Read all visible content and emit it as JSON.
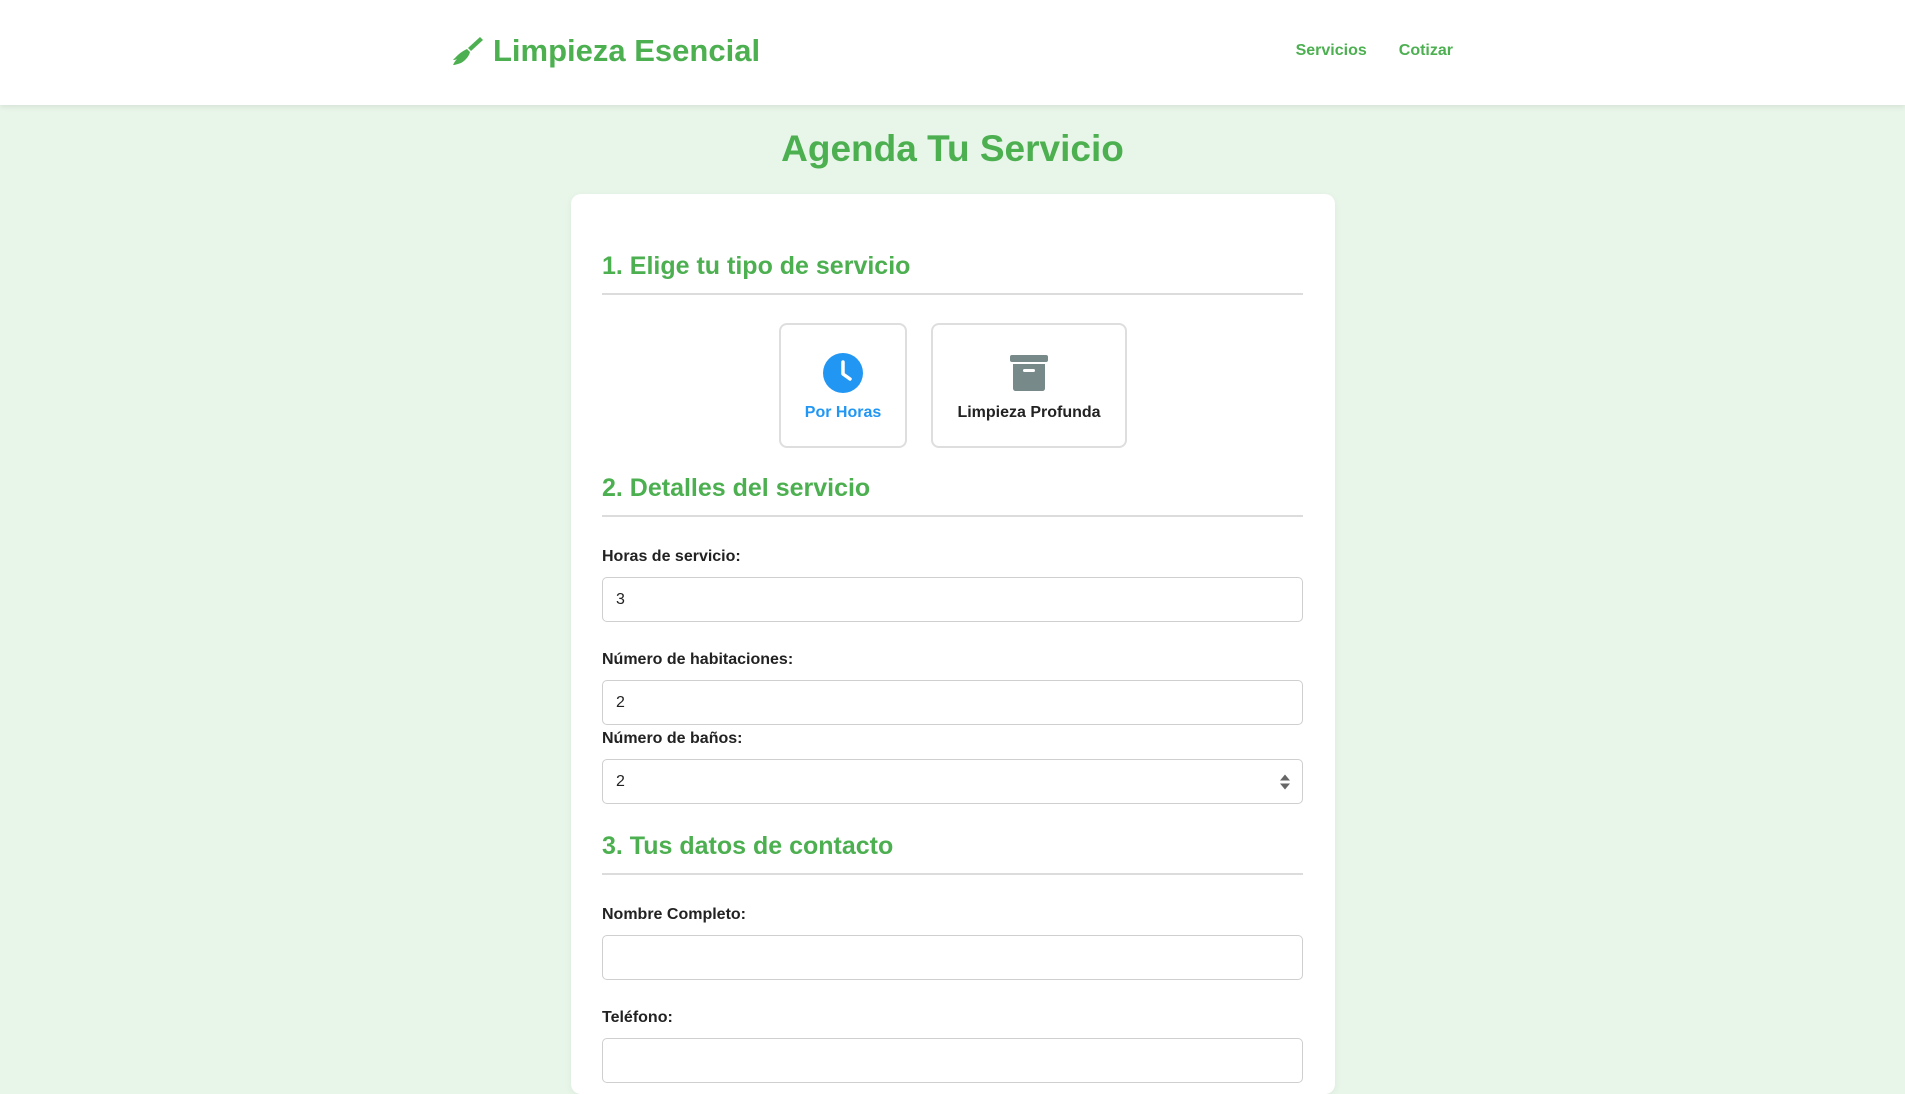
{
  "header": {
    "logo_text": "Limpieza Esencial",
    "nav": [
      {
        "label": "Servicios"
      },
      {
        "label": "Cotizar"
      }
    ]
  },
  "page_title": "Agenda Tu Servicio",
  "sections": {
    "service_type": {
      "title": "1. Elige tu tipo de servicio",
      "options": [
        {
          "label": "Por Horas",
          "icon": "clock-icon",
          "selected": true
        },
        {
          "label": "Limpieza Profunda",
          "icon": "archive-box-icon",
          "selected": false
        }
      ]
    },
    "details": {
      "title": "2. Detalles del servicio",
      "hours_label": "Horas de servicio:",
      "hours_value": "3",
      "rooms_label": "Número de habitaciones:",
      "rooms_value": "2",
      "baths_label": "Número de baños:",
      "baths_value": "2"
    },
    "contact": {
      "title": "3. Tus datos de contacto",
      "name_label": "Nombre Completo:",
      "name_value": "",
      "phone_label": "Teléfono:",
      "phone_value": ""
    }
  },
  "colors": {
    "brand_green": "#4caf50",
    "selected_blue": "#2196f3",
    "page_background": "#e8f5e9",
    "icon_gray": "#78898a"
  }
}
